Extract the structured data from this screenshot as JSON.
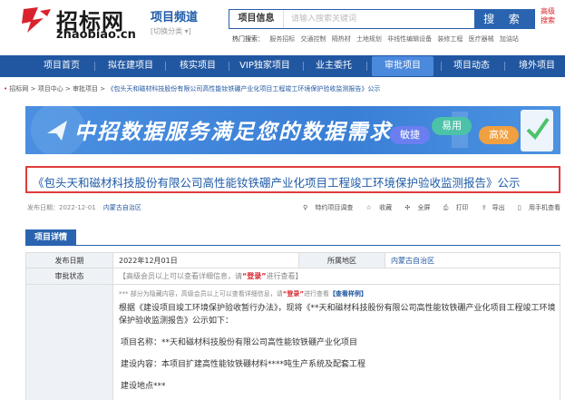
{
  "header": {
    "logo_cn": "招标网",
    "logo_en": "zhaobiao.cn",
    "channel_title": "项目频道",
    "channel_switch": "[切换分类 ▾]",
    "search_type": "项目信息",
    "search_placeholder": "请输入搜索关键词",
    "search_button": "搜 索",
    "advanced_1": "高级",
    "advanced_2": "搜索",
    "hot_label": "热门搜索：",
    "hot_items": [
      "服务招标",
      "交通控制",
      "隔热材",
      "土地规划",
      "非线性编辑设备",
      "装修工程",
      "医疗器械",
      "加油站"
    ]
  },
  "nav": {
    "items": [
      "项目首页",
      "拟在建项目",
      "核实项目",
      "VIP独家项目",
      "业主委托",
      "审批项目",
      "项目动态",
      "境外项目"
    ],
    "active": "审批项目"
  },
  "breadcrumb": {
    "items": [
      "招标网",
      "项目中心",
      "审批项目"
    ],
    "current": "《包头天和磁材科技股份有限公司高性能钕铁硼产业化项目工程竣工环境保护验收监测报告》公示"
  },
  "banner": {
    "text": "中招数据服务满足您的数据需求",
    "pills": [
      "敏捷",
      "易用",
      "高效"
    ]
  },
  "title": "《包头天和磁材科技股份有限公司高性能钕铁硼产业化项目工程竣工环境保护验收监测报告》公示",
  "meta": {
    "date_label": "发布日期：",
    "date": "2022-12-01",
    "region": "内蒙古自治区",
    "actions": [
      "特约项目调查",
      "收藏",
      "全屏",
      "打印",
      "导出",
      "用手机查看"
    ]
  },
  "detail": {
    "tab": "项目详情",
    "publish_date_label": "发布日期",
    "publish_date": "2022年12月01日",
    "region_label": "所属地区",
    "region": "内蒙古自治区",
    "status_label": "审批状态",
    "status_prefix": "【高级会员以上可以查看详细信息，请",
    "status_login": "“登录”",
    "status_suffix": "进行查看】",
    "hidden_prefix": "*** 部分为隐藏内容，高级会员以上可以查看详细信息，请",
    "hidden_login": "“登录”",
    "hidden_mid": "进行查看",
    "hidden_sample": "【查看样例】",
    "para1": "根据《建设项目竣工环境保护验收暂行办法》，现将《**天和磁材科技股份有限公司高性能钕铁硼产业化项目工程竣工环境保护验收监测报告》公示如下：",
    "project_name": "项目名称：**天和磁材科技股份有限公司高性能钕铁硼产业化项目",
    "build_content": "建设内容：本项目扩建高性能钕铁硼材料****吨生产系统及配套工程",
    "build_location": "建设地点***"
  },
  "colors": {
    "nav_bg": "#2157a1",
    "nav_active": "#4a89dc",
    "title_border": "#e03c3c",
    "link_blue": "#1f5ba8",
    "accent_red": "#d9232d"
  }
}
